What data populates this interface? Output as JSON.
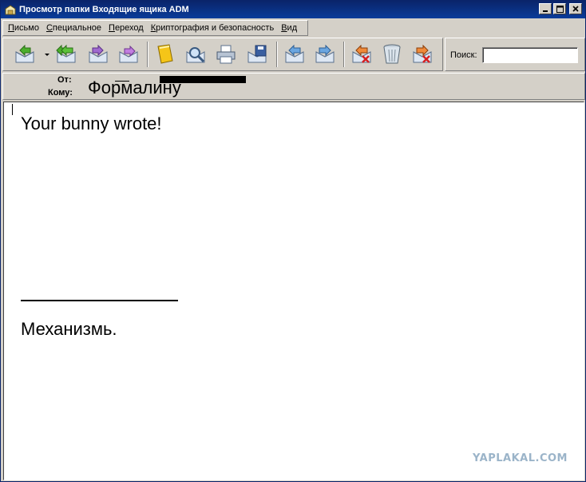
{
  "window": {
    "title": "Просмотр папки Входящие ящика ADM",
    "controls": [
      "_",
      "□",
      "×"
    ]
  },
  "menu": {
    "items": [
      {
        "label": "Письмо",
        "accel": "П"
      },
      {
        "label": "Специальное",
        "accel": "С"
      },
      {
        "label": "Переход",
        "accel": "П"
      },
      {
        "label": "Криптография и безопасность",
        "accel": "К"
      },
      {
        "label": "Вид",
        "accel": "В"
      }
    ]
  },
  "toolbar": {
    "buttons": [
      {
        "name": "reply-icon"
      },
      {
        "name": "reply-all-icon"
      },
      {
        "name": "forward-icon"
      },
      {
        "name": "redirect-icon"
      },
      {
        "name": "address-book-icon"
      },
      {
        "name": "find-icon"
      },
      {
        "name": "print-icon"
      },
      {
        "name": "save-icon"
      },
      {
        "name": "previous-message-icon"
      },
      {
        "name": "next-message-icon"
      },
      {
        "name": "delete-previous-icon"
      },
      {
        "name": "trash-icon"
      },
      {
        "name": "delete-next-icon"
      }
    ]
  },
  "search": {
    "label": "Поиск:",
    "value": "",
    "placeholder": ""
  },
  "headers": {
    "from_label": "От:",
    "to_label": "Кому:",
    "to_value": "Формалину"
  },
  "message": {
    "lines": [
      "Your bunny wrote!",
      "Механизмь."
    ]
  },
  "watermark": "YAPLAKAL.COM",
  "colors": {
    "titlebar": "#0a246a",
    "chrome": "#d4d0c8",
    "watermark": "#9bb4c9"
  }
}
